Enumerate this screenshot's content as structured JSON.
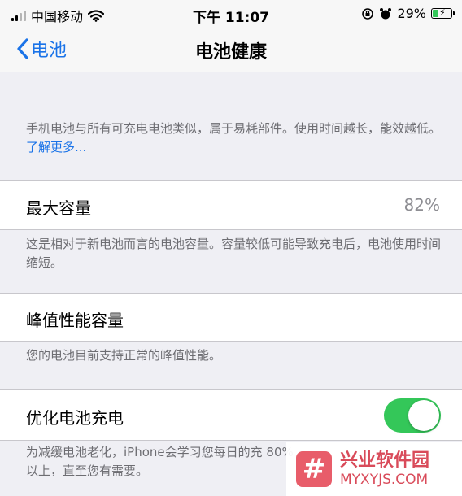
{
  "status_bar": {
    "carrier": "中国移动",
    "time": "下午 11:07",
    "battery_percent": "29%",
    "icons": [
      "signal-icon",
      "wifi-icon",
      "orientation-lock-icon",
      "alarm-icon",
      "battery-charging-icon"
    ]
  },
  "nav": {
    "back_label": "电池",
    "title": "电池健康"
  },
  "intro": {
    "text": "手机电池与所有可充电电池类似，属于易耗部件。使用时间越长，能效越低。",
    "link": "了解更多..."
  },
  "max_capacity": {
    "label": "最大容量",
    "value": "82%",
    "footnote": "这是相对于新电池而言的电池容量。容量较低可能导致充电后，电池使用时间缩短。"
  },
  "peak_performance": {
    "label": "峰值性能容量",
    "footnote": "您的电池目前支持正常的峰值性能。"
  },
  "optimized_charging": {
    "label": "优化电池充电",
    "enabled": true,
    "footnote": "为减缓电池老化，iPhone会学习您每日的充 80%以上，直至您有需要。"
  },
  "watermark": {
    "logo_glyph": "#",
    "name": "兴业软件园",
    "url": "MYXYJS.COM"
  },
  "colors": {
    "accent": "#1a73e8",
    "toggle_on": "#34c759",
    "background": "#efeff4"
  }
}
